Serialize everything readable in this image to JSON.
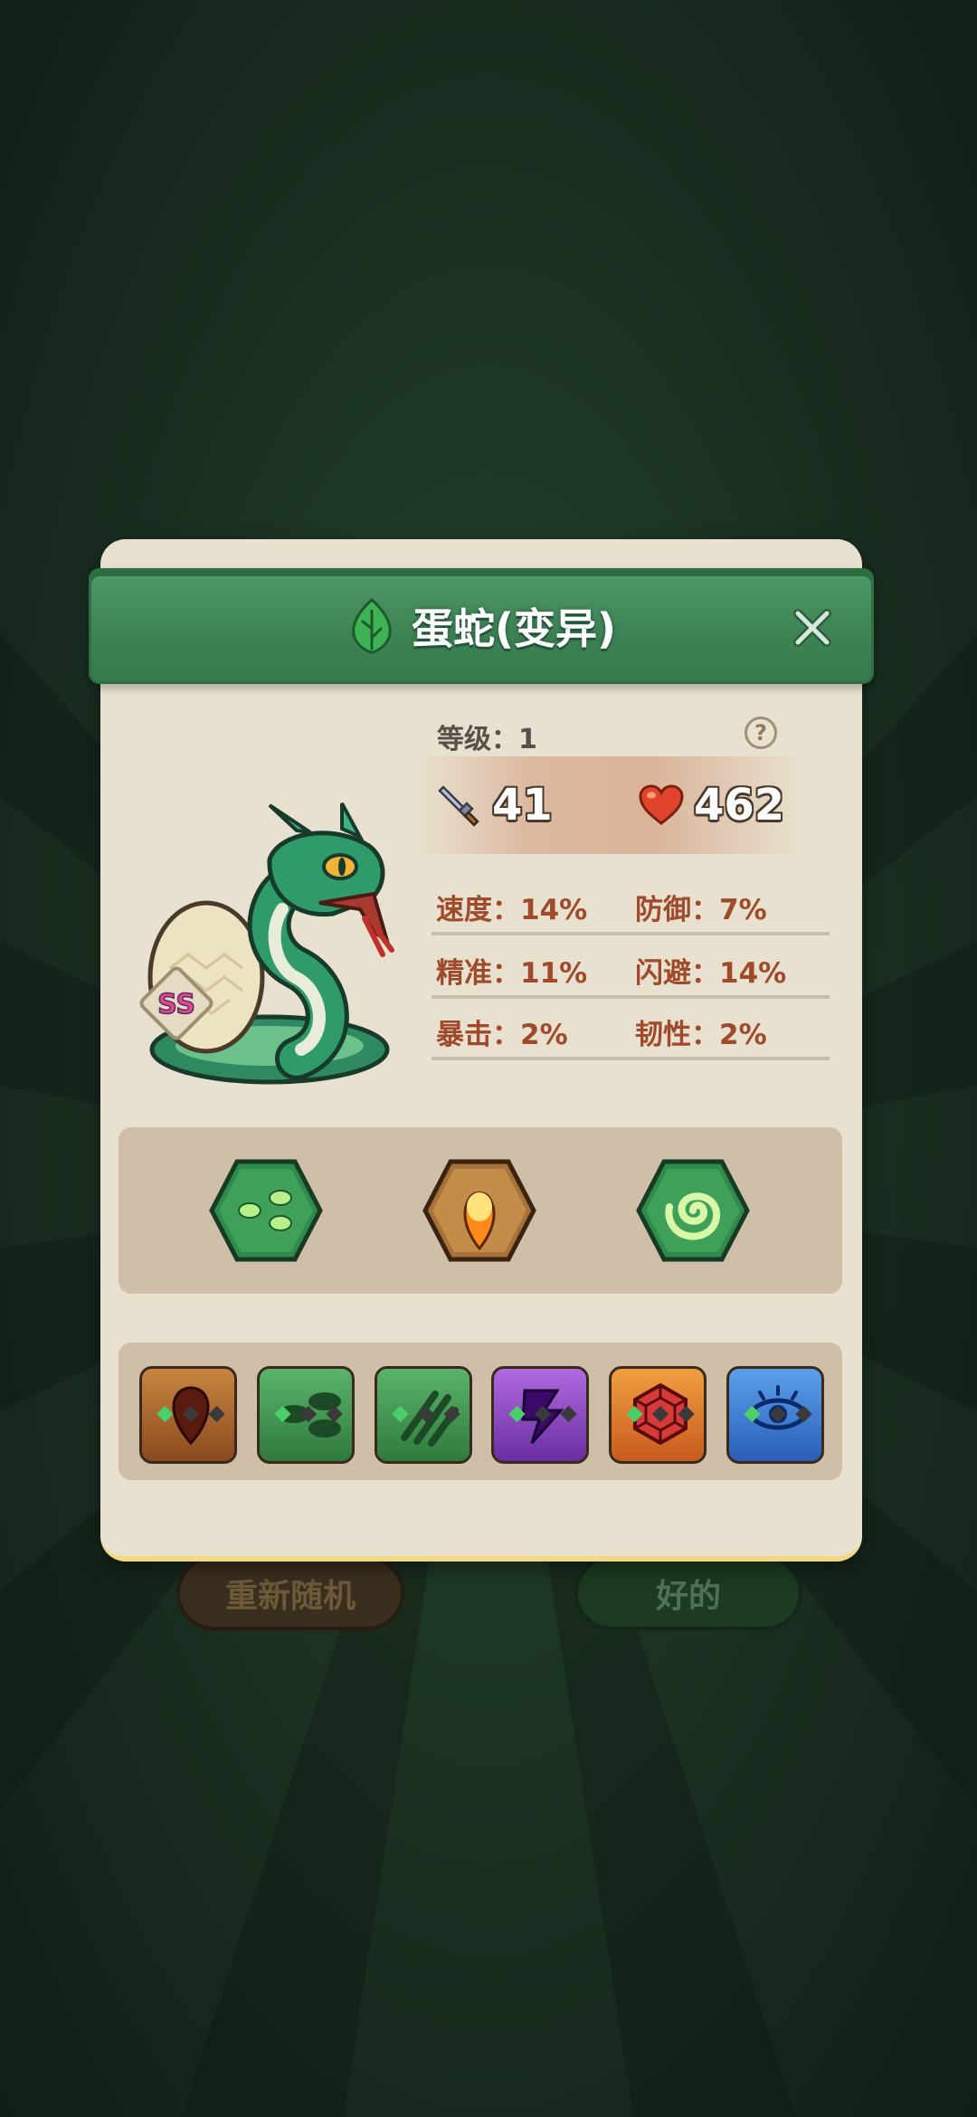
{
  "dialog": {
    "title": "蛋蛇(变异)",
    "level": "等级：1",
    "help": "?",
    "attack": "41",
    "hp": "462",
    "rank_badge": "SS",
    "stats": [
      {
        "left": "速度：14%",
        "right": "防御：7%"
      },
      {
        "left": "精准：11%",
        "right": "闪避：14%"
      },
      {
        "left": "暴击：2%",
        "right": "韧性：2%"
      }
    ],
    "skills": [
      "poison-seeds-icon",
      "flame-drop-icon",
      "green-swirl-icon"
    ],
    "traits": [
      {
        "icon": "blood-drop-icon",
        "color": "#9a5a2a"
      },
      {
        "icon": "leaves-icon",
        "color": "#3e8a4c"
      },
      {
        "icon": "slash-claw-icon",
        "color": "#3f8a52"
      },
      {
        "icon": "lightning-icon",
        "color": "#8845b8"
      },
      {
        "icon": "hex-shield-icon",
        "color": "#d8702a"
      },
      {
        "icon": "eye-icon",
        "color": "#3a79c8"
      }
    ]
  },
  "buttons": {
    "reroll": "重新随机",
    "ok": "好的"
  },
  "colors": {
    "title_bar": "#3f8558",
    "panel": "#e8e1cf",
    "stat_text": "#a04a2c"
  }
}
